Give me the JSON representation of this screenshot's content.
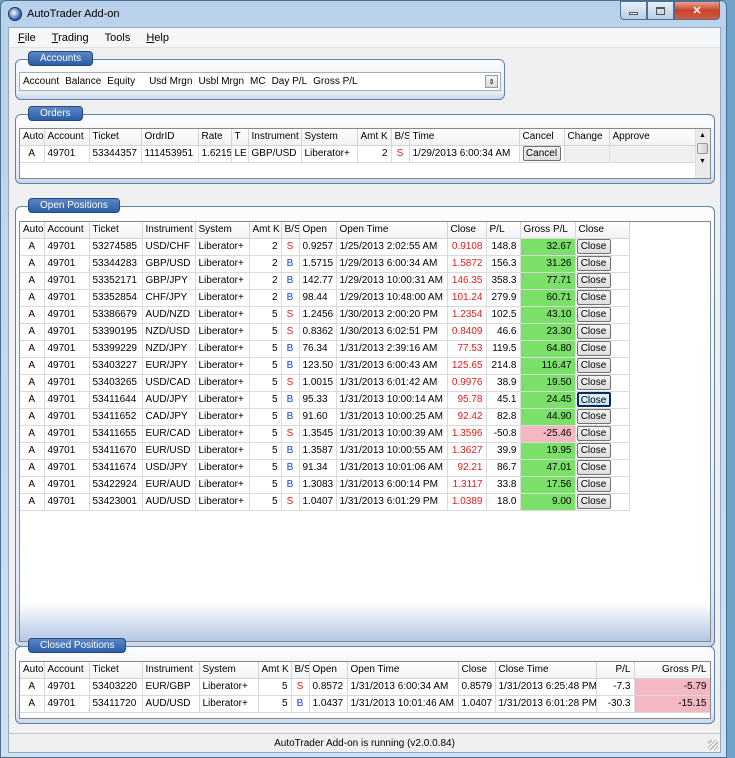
{
  "window": {
    "title": "AutoTrader Add-on"
  },
  "menu": [
    {
      "accel": "F",
      "rest": "ile"
    },
    {
      "accel": "T",
      "rest": "rading"
    },
    {
      "accel": "",
      "rest": "Tools"
    },
    {
      "accel": "H",
      "rest": "elp"
    }
  ],
  "accounts": {
    "label": "Accounts",
    "columns": [
      "Account",
      "Balance",
      "Equity",
      "Usd Mrgn",
      "Usbl Mrgn",
      "MC",
      "Day P/L",
      "Gross P/L"
    ]
  },
  "orders": {
    "label": "Orders",
    "columns": [
      "Auto",
      "Account",
      "Ticket",
      "OrdrID",
      "Rate",
      "T",
      "Instrument",
      "System",
      "Amt K",
      "B/S",
      "Time",
      "Cancel",
      "Change",
      "Approve"
    ],
    "rows": [
      {
        "auto": "A",
        "account": "49701",
        "ticket": "53344357",
        "ordrid": "111453951",
        "rate": "1.6215",
        "t": "LE",
        "instrument": "GBP/USD",
        "system": "Liberator+",
        "amt": "2",
        "bs": "S",
        "time": "1/29/2013 6:00:34 AM",
        "cancel": "Cancel"
      }
    ]
  },
  "open_positions": {
    "label": "Open Positions",
    "columns": [
      "Auto",
      "Account",
      "Ticket",
      "Instrument",
      "System",
      "Amt K",
      "B/S",
      "Open",
      "Open Time",
      "Close",
      "P/L",
      "Gross P/L",
      "Close"
    ],
    "rows": [
      {
        "auto": "A",
        "account": "49701",
        "ticket": "53274585",
        "instrument": "USD/CHF",
        "system": "Liberator+",
        "amt": "2",
        "bs": "S",
        "open": "0.9257",
        "open_time": "1/25/2013 2:02:55 AM",
        "close": "0.9108",
        "pl": "148.8",
        "gross": "32.67",
        "btn": "Close"
      },
      {
        "auto": "A",
        "account": "49701",
        "ticket": "53344283",
        "instrument": "GBP/USD",
        "system": "Liberator+",
        "amt": "2",
        "bs": "B",
        "open": "1.5715",
        "open_time": "1/29/2013 6:00:34 AM",
        "close": "1.5872",
        "pl": "156.3",
        "gross": "31.26",
        "btn": "Close"
      },
      {
        "auto": "A",
        "account": "49701",
        "ticket": "53352171",
        "instrument": "GBP/JPY",
        "system": "Liberator+",
        "amt": "2",
        "bs": "B",
        "open": "142.77",
        "open_time": "1/29/2013 10:00:31 AM",
        "close": "146.35",
        "pl": "358.3",
        "gross": "77.71",
        "btn": "Close"
      },
      {
        "auto": "A",
        "account": "49701",
        "ticket": "53352854",
        "instrument": "CHF/JPY",
        "system": "Liberator+",
        "amt": "2",
        "bs": "B",
        "open": "98.44",
        "open_time": "1/29/2013 10:48:00 AM",
        "close": "101.24",
        "pl": "279.9",
        "gross": "60.71",
        "btn": "Close"
      },
      {
        "auto": "A",
        "account": "49701",
        "ticket": "53386679",
        "instrument": "AUD/NZD",
        "system": "Liberator+",
        "amt": "5",
        "bs": "S",
        "open": "1.2456",
        "open_time": "1/30/2013 2:00:20 PM",
        "close": "1.2354",
        "pl": "102.5",
        "gross": "43.10",
        "btn": "Close"
      },
      {
        "auto": "A",
        "account": "49701",
        "ticket": "53390195",
        "instrument": "NZD/USD",
        "system": "Liberator+",
        "amt": "5",
        "bs": "S",
        "open": "0.8362",
        "open_time": "1/30/2013 6:02:51 PM",
        "close": "0.8409",
        "pl": "46.6",
        "gross": "23.30",
        "btn": "Close"
      },
      {
        "auto": "A",
        "account": "49701",
        "ticket": "53399229",
        "instrument": "NZD/JPY",
        "system": "Liberator+",
        "amt": "5",
        "bs": "B",
        "open": "76.34",
        "open_time": "1/31/2013 2:39:16 AM",
        "close": "77.53",
        "pl": "119.5",
        "gross": "64.80",
        "btn": "Close"
      },
      {
        "auto": "A",
        "account": "49701",
        "ticket": "53403227",
        "instrument": "EUR/JPY",
        "system": "Liberator+",
        "amt": "5",
        "bs": "B",
        "open": "123.50",
        "open_time": "1/31/2013 6:00:43 AM",
        "close": "125.65",
        "pl": "214.8",
        "gross": "116.47",
        "btn": "Close"
      },
      {
        "auto": "A",
        "account": "49701",
        "ticket": "53403265",
        "instrument": "USD/CAD",
        "system": "Liberator+",
        "amt": "5",
        "bs": "S",
        "open": "1.0015",
        "open_time": "1/31/2013 6:01:42 AM",
        "close": "0.9976",
        "pl": "38.9",
        "gross": "19.50",
        "btn": "Close"
      },
      {
        "auto": "A",
        "account": "49701",
        "ticket": "53411644",
        "instrument": "AUD/JPY",
        "system": "Liberator+",
        "amt": "5",
        "bs": "B",
        "open": "95.33",
        "open_time": "1/31/2013 10:00:14 AM",
        "close": "95.78",
        "pl": "45.1",
        "gross": "24.45",
        "btn": "Close",
        "focus": true
      },
      {
        "auto": "A",
        "account": "49701",
        "ticket": "53411652",
        "instrument": "CAD/JPY",
        "system": "Liberator+",
        "amt": "5",
        "bs": "B",
        "open": "91.60",
        "open_time": "1/31/2013 10:00:25 AM",
        "close": "92.42",
        "pl": "82.8",
        "gross": "44.90",
        "btn": "Close"
      },
      {
        "auto": "A",
        "account": "49701",
        "ticket": "53411655",
        "instrument": "EUR/CAD",
        "system": "Liberator+",
        "amt": "5",
        "bs": "S",
        "open": "1.3545",
        "open_time": "1/31/2013 10:00:39 AM",
        "close": "1.3596",
        "pl": "-50.8",
        "gross": "-25.46",
        "btn": "Close",
        "loss": true
      },
      {
        "auto": "A",
        "account": "49701",
        "ticket": "53411670",
        "instrument": "EUR/USD",
        "system": "Liberator+",
        "amt": "5",
        "bs": "B",
        "open": "1.3587",
        "open_time": "1/31/2013 10:00:55 AM",
        "close": "1.3627",
        "pl": "39.9",
        "gross": "19.95",
        "btn": "Close"
      },
      {
        "auto": "A",
        "account": "49701",
        "ticket": "53411674",
        "instrument": "USD/JPY",
        "system": "Liberator+",
        "amt": "5",
        "bs": "B",
        "open": "91.34",
        "open_time": "1/31/2013 10:01:06 AM",
        "close": "92.21",
        "pl": "86.7",
        "gross": "47.01",
        "btn": "Close"
      },
      {
        "auto": "A",
        "account": "49701",
        "ticket": "53422924",
        "instrument": "EUR/AUD",
        "system": "Liberator+",
        "amt": "5",
        "bs": "B",
        "open": "1.3083",
        "open_time": "1/31/2013 6:00:14 PM",
        "close": "1.3117",
        "pl": "33.8",
        "gross": "17.56",
        "btn": "Close"
      },
      {
        "auto": "A",
        "account": "49701",
        "ticket": "53423001",
        "instrument": "AUD/USD",
        "system": "Liberator+",
        "amt": "5",
        "bs": "S",
        "open": "1.0407",
        "open_time": "1/31/2013 6:01:29 PM",
        "close": "1.0389",
        "pl": "18.0",
        "gross": "9.00",
        "btn": "Close"
      }
    ]
  },
  "closed_positions": {
    "label": "Closed Positions",
    "columns": [
      "Auto",
      "Account",
      "Ticket",
      "Instrument",
      "System",
      "Amt K",
      "B/S",
      "Open",
      "Open Time",
      "Close",
      "Close Time",
      "P/L",
      "Gross P/L"
    ],
    "rows": [
      {
        "auto": "A",
        "account": "49701",
        "ticket": "53403220",
        "instrument": "EUR/GBP",
        "system": "Liberator+",
        "amt": "5",
        "bs": "S",
        "open": "0.8572",
        "open_time": "1/31/2013 6:00:34 AM",
        "close": "0.8579",
        "close_time": "1/31/2013 6:25:48 PM",
        "pl": "-7.3",
        "gross": "-5.79"
      },
      {
        "auto": "A",
        "account": "49701",
        "ticket": "53411720",
        "instrument": "AUD/USD",
        "system": "Liberator+",
        "amt": "5",
        "bs": "B",
        "open": "1.0437",
        "open_time": "1/31/2013 10:01:46 AM",
        "close": "1.0407",
        "close_time": "1/31/2013 6:01:28 PM",
        "pl": "-30.3",
        "gross": "-15.15"
      }
    ]
  },
  "status": "AutoTrader Add-on is running (v2.0.0.84)",
  "colors": {
    "profit": "#7ae069",
    "loss": "#f4b8c3",
    "sell": "#e0201c",
    "buy": "#1540d8"
  }
}
